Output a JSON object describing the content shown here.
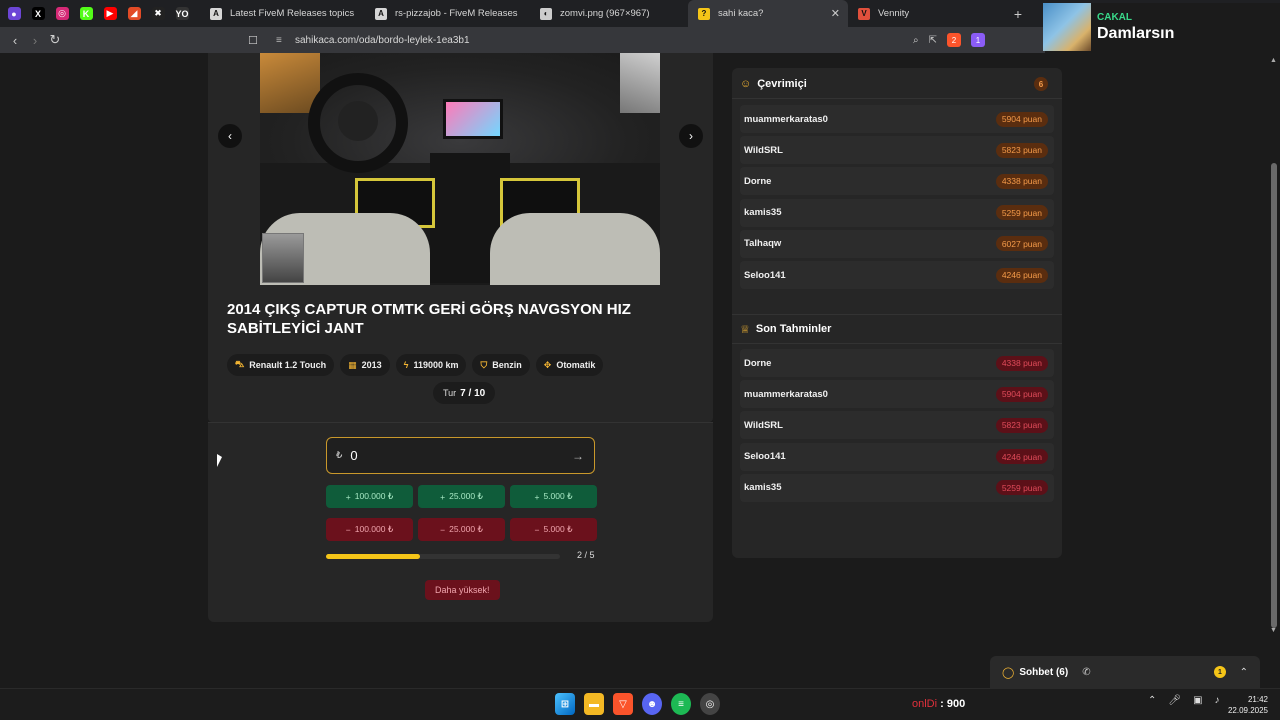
{
  "browser": {
    "pinned_tabs": [
      {
        "icon": "stream-icon",
        "color": "#6c46d6",
        "glyph": "●"
      },
      {
        "icon": "x-icon",
        "color": "#000000",
        "glyph": "X"
      },
      {
        "icon": "instagram-icon",
        "color": "#d62976",
        "glyph": "◎"
      },
      {
        "icon": "kick-icon",
        "color": "#53fc18",
        "glyph": "K"
      },
      {
        "icon": "youtube-icon",
        "color": "#ff0000",
        "glyph": "▶"
      },
      {
        "icon": "app-icon",
        "color": "#e24b26",
        "glyph": "◢"
      },
      {
        "icon": "crossout-icon",
        "color": "#222222",
        "glyph": "✖"
      },
      {
        "icon": "yo-icon",
        "color": "#333333",
        "glyph": "YO"
      }
    ],
    "tabs": [
      {
        "title": "Latest FiveM Releases topics - Cfx.re",
        "fav_color": "#d6d6d6",
        "glyph": "A",
        "active": false
      },
      {
        "title": "rs-pizzajob - FiveM Releases - Cfx.re",
        "fav_color": "#d6d6d6",
        "glyph": "A",
        "active": false
      },
      {
        "title": "zomvi.png (967×967)",
        "fav_color": "#cccccc",
        "glyph": "◐",
        "active": false
      },
      {
        "title": "sahi kaca?",
        "fav_color": "#f5c518",
        "glyph": "?",
        "active": true
      },
      {
        "title": "Vennity",
        "fav_color": "#e0503c",
        "glyph": "V",
        "active": false
      }
    ],
    "url": "sahikaca.com/oda/bordo-leylek-1ea3b1",
    "shield_count": "2",
    "rewards_count": "1"
  },
  "media": {
    "artist": "CAKAL",
    "song": "Damlarsın"
  },
  "listing": {
    "title": "2014 ÇIKŞ CAPTUR OTMTK GERİ GÖRŞ NAVGSYON HIZ SABİTLEYİCİ JANT",
    "chips": [
      {
        "icon": "car-icon",
        "glyph": "⛍",
        "label": "Renault 1.2 Touch"
      },
      {
        "icon": "calendar-icon",
        "glyph": "▦",
        "label": "2013"
      },
      {
        "icon": "speed-icon",
        "glyph": "ϟ",
        "label": "119000 km"
      },
      {
        "icon": "fuel-icon",
        "glyph": "⛉",
        "label": "Benzin"
      },
      {
        "icon": "gear-icon",
        "glyph": "✥",
        "label": "Otomatik"
      }
    ],
    "round_label": "Tur",
    "round_value": "7 / 10"
  },
  "guess": {
    "currency": "₺",
    "value": "0",
    "plus_buttons": [
      "100.000 ₺",
      "25.000 ₺",
      "5.000 ₺"
    ],
    "minus_buttons": [
      "100.000 ₺",
      "25.000 ₺",
      "5.000 ₺"
    ],
    "progress_label": "2 / 5",
    "progress_fraction": 0.4,
    "hint": "Daha yüksek!"
  },
  "online": {
    "title": "Çevrimiçi",
    "count": "6",
    "players": [
      {
        "name": "muammerkaratas0",
        "points": "5904 puan"
      },
      {
        "name": "WildSRL",
        "points": "5823 puan"
      },
      {
        "name": "Dorne",
        "points": "4338 puan"
      },
      {
        "name": "kamis35",
        "points": "5259 puan"
      },
      {
        "name": "Talhaqw",
        "points": "6027 puan"
      },
      {
        "name": "Seloo141",
        "points": "4246 puan"
      }
    ]
  },
  "recent": {
    "title": "Son Tahminler",
    "guesses": [
      {
        "name": "Dorne",
        "points": "4338 puan"
      },
      {
        "name": "muammerkaratas0",
        "points": "5904 puan"
      },
      {
        "name": "WildSRL",
        "points": "5823 puan"
      },
      {
        "name": "Seloo141",
        "points": "4246 puan"
      },
      {
        "name": "kamis35",
        "points": "5259 puan"
      }
    ]
  },
  "chat": {
    "label": "Sohbet (6)",
    "badge": "1"
  },
  "taskbar": {
    "live_prefix": "onlDi",
    "live_value": ": 900",
    "time": "21:42",
    "date": "22.09.2025"
  }
}
